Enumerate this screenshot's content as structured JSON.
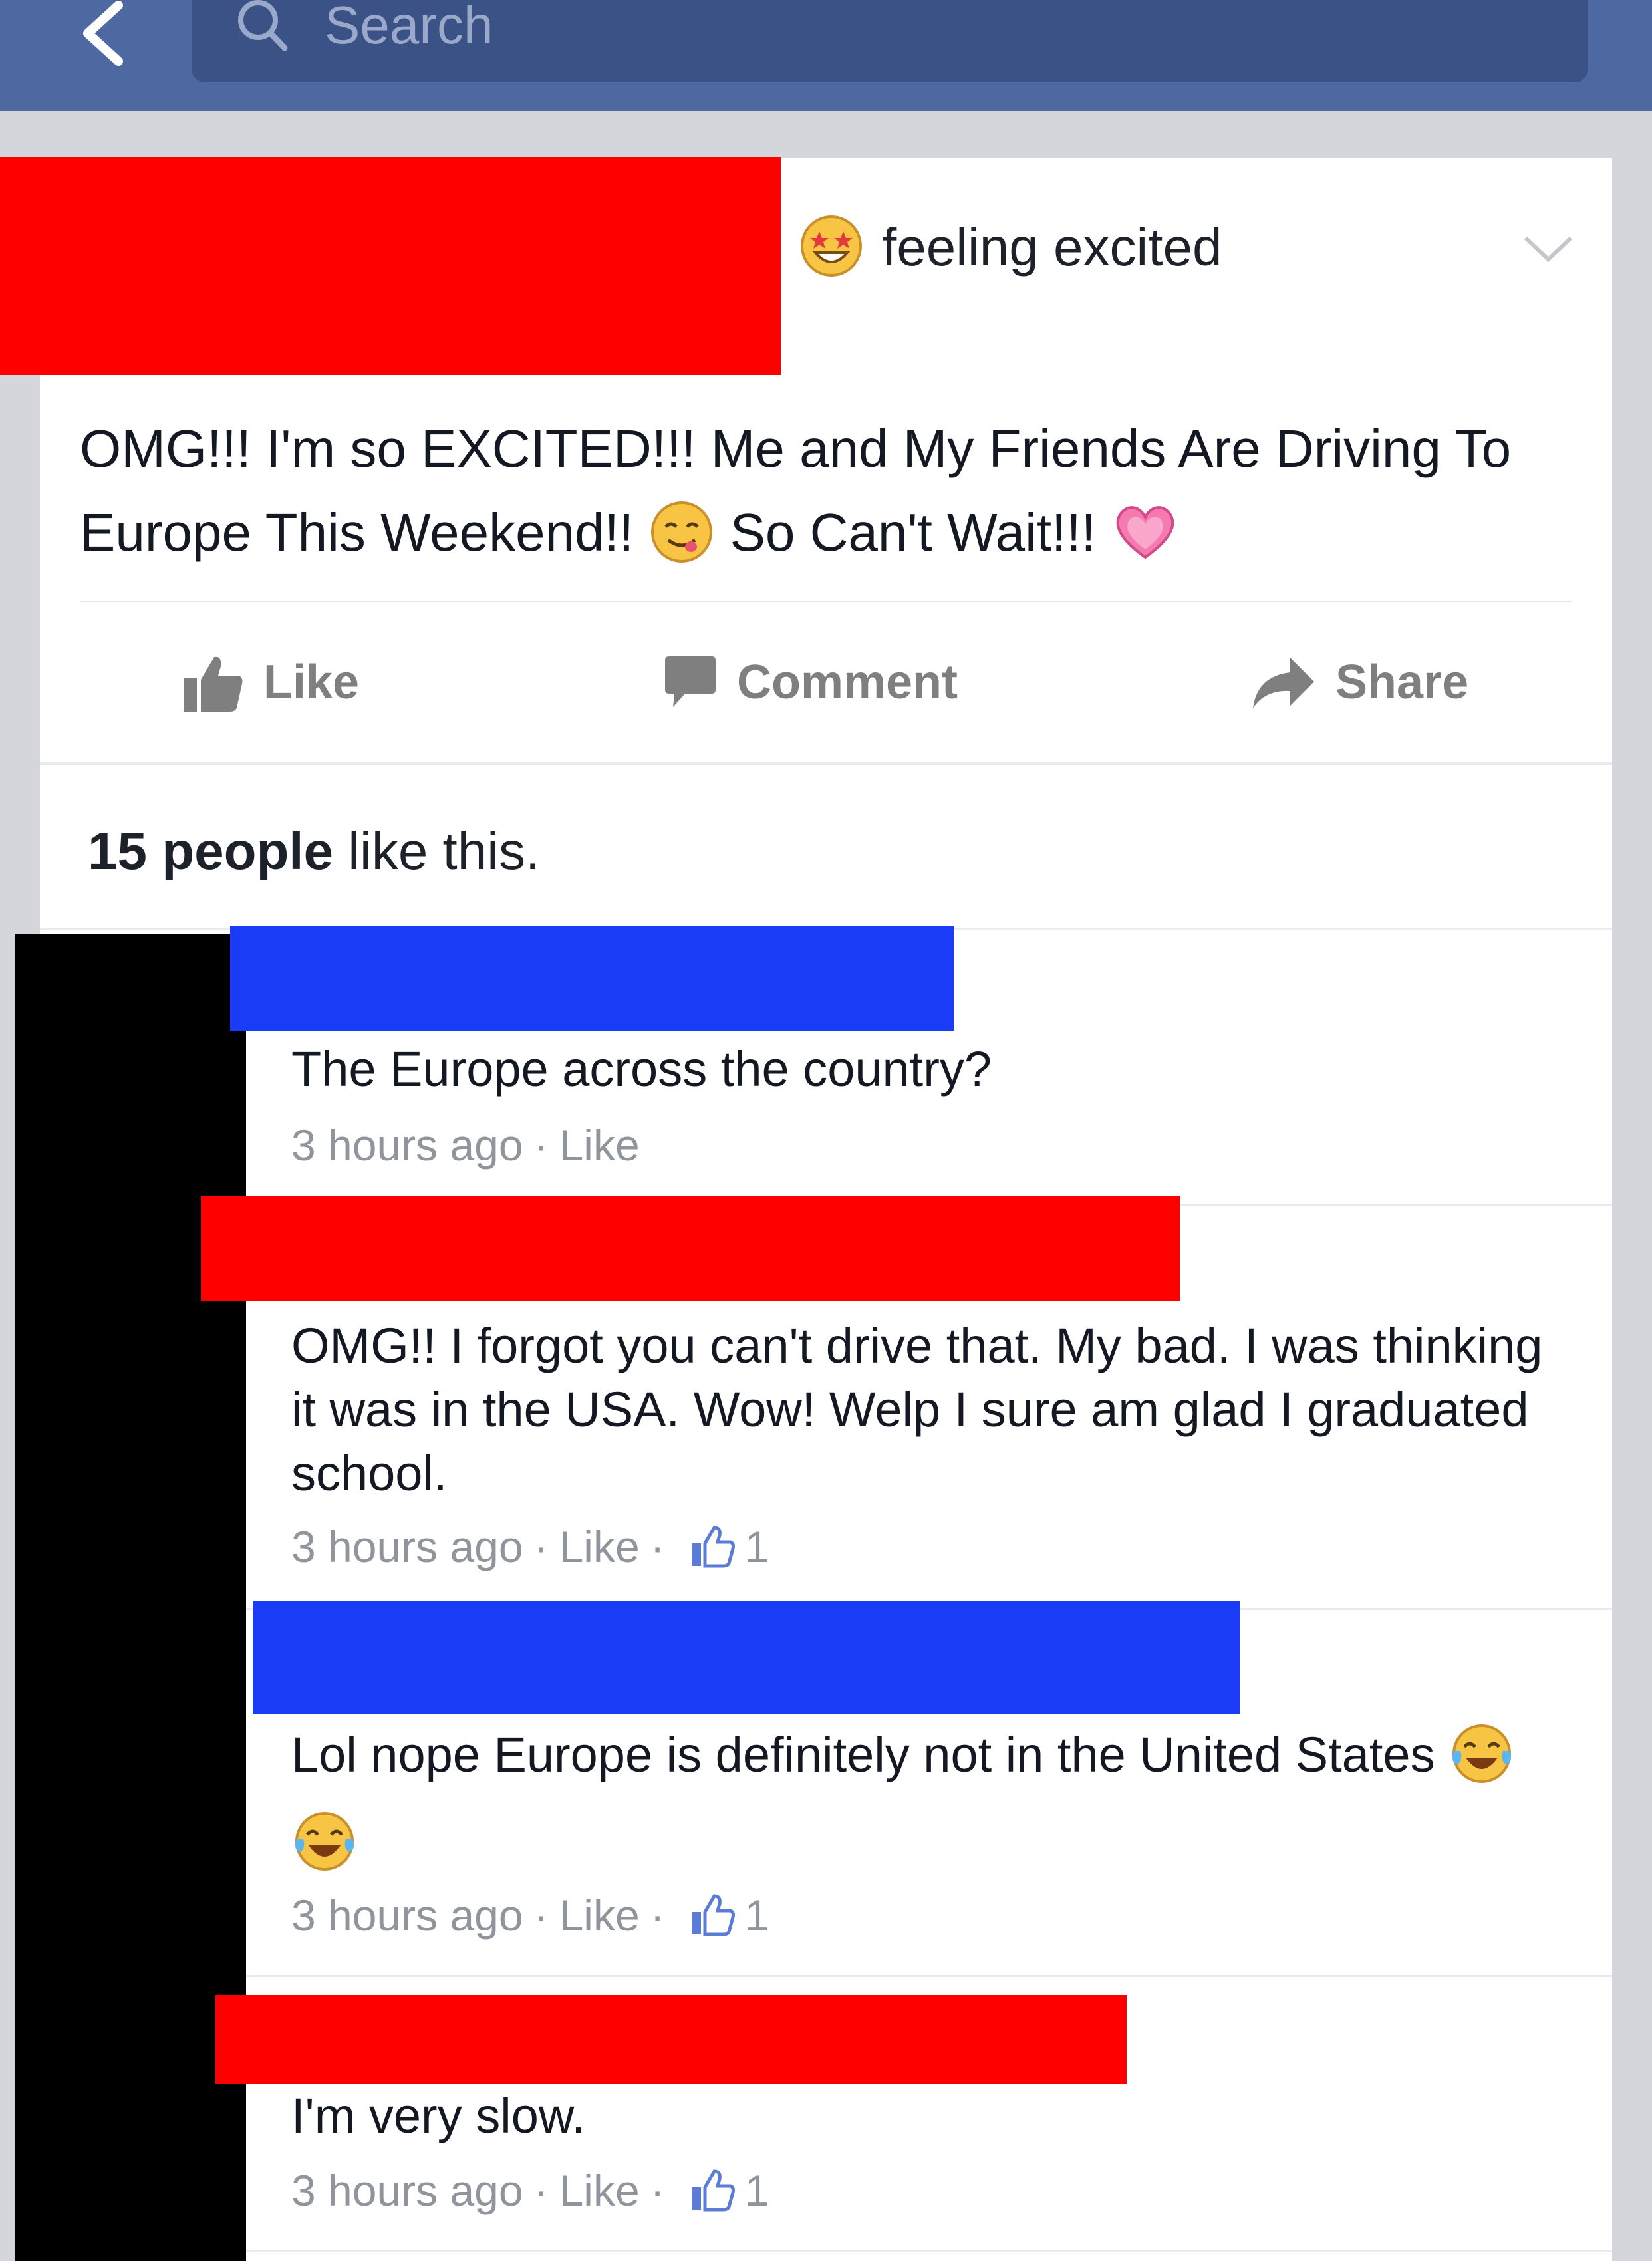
{
  "topbar": {
    "search_placeholder": "Search"
  },
  "post": {
    "feeling": "feeling excited",
    "text_line1": "OMG!!! I'm so EXCITED!!! Me and My Friends Are Driving To",
    "text_line2a": "Europe This Weekend!!",
    "text_line2b": "So Can't Wait!!!",
    "actions": {
      "like": "Like",
      "comment": "Comment",
      "share": "Share"
    },
    "likes_count": "15 people",
    "likes_suffix": "like this."
  },
  "comments": [
    {
      "text": "The Europe across the country?",
      "time": "3 hours ago",
      "like": "Like",
      "count": ""
    },
    {
      "text": "OMG!! I forgot you can't drive that. My bad. I was thinking it was in the USA. Wow! Welp I sure am glad I graduated school.",
      "time": "3 hours ago",
      "like": "Like",
      "count": "1"
    },
    {
      "text": "Lol nope Europe is definitely not in the United States",
      "time": "3 hours ago",
      "like": "Like",
      "count": "1"
    },
    {
      "text": "I'm very slow.",
      "time": "3 hours ago",
      "like": "Like",
      "count": "1"
    }
  ],
  "colors": {
    "header": "#4e69a2",
    "redaction_red": "#ff0000",
    "redaction_blue": "#1a3cf6"
  }
}
